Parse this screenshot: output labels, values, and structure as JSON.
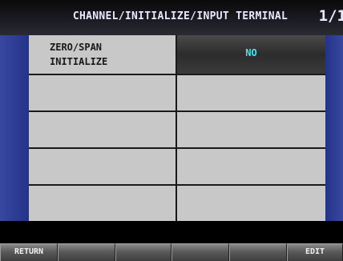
{
  "header": {
    "title": "CHANNEL/INITIALIZE/INPUT TERMINAL",
    "page": "1/1"
  },
  "table": {
    "rows": [
      {
        "label_line1": "ZERO/SPAN",
        "label_line2": "INITIALIZE",
        "value": "NO"
      },
      {
        "label_line1": "",
        "label_line2": "",
        "value": ""
      },
      {
        "label_line1": "",
        "label_line2": "",
        "value": ""
      },
      {
        "label_line1": "",
        "label_line2": "",
        "value": ""
      },
      {
        "label_line1": "",
        "label_line2": "",
        "value": ""
      }
    ]
  },
  "softkeys": [
    "RETURN",
    "",
    "",
    "",
    "",
    "EDIT"
  ],
  "colors": {
    "value_text": "#40e8f0",
    "field_blue": "#1e2c78",
    "cell_gray": "#c8c8c8",
    "header_text": "#e8e8ff"
  }
}
